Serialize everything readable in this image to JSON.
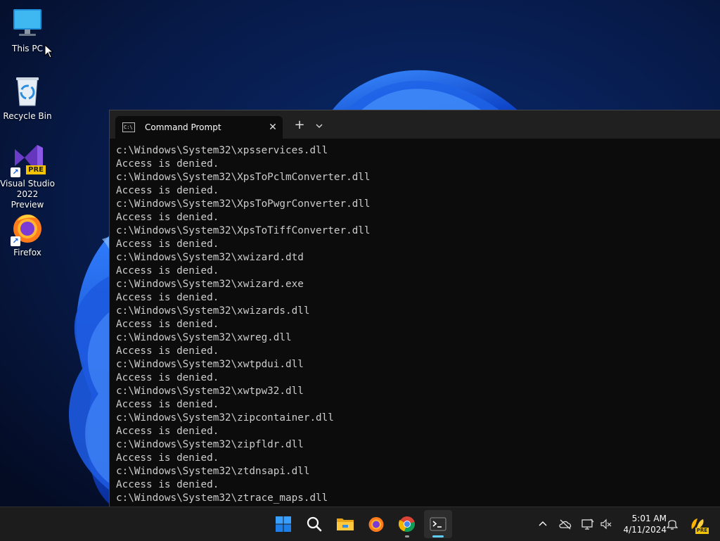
{
  "desktop": {
    "icons": [
      {
        "label": "This PC",
        "icon": "monitor-icon"
      },
      {
        "label": "Recycle Bin",
        "icon": "recycle-bin-icon"
      },
      {
        "label": "Visual Studio\n2022 Preview",
        "label_line1": "Visual Studio",
        "label_line2": "2022 Preview",
        "badge": "PRE",
        "icon": "visual-studio-icon"
      },
      {
        "label": "Firefox",
        "icon": "firefox-icon"
      }
    ]
  },
  "terminal": {
    "tab_title": "Command Prompt",
    "tab_icon_text": "C:\\",
    "close_symbol": "✕",
    "new_tab_symbol": "+",
    "lines": [
      "c:\\Windows\\System32\\xpsservices.dll",
      "Access is denied.",
      "c:\\Windows\\System32\\XpsToPclmConverter.dll",
      "Access is denied.",
      "c:\\Windows\\System32\\XpsToPwgrConverter.dll",
      "Access is denied.",
      "c:\\Windows\\System32\\XpsToTiffConverter.dll",
      "Access is denied.",
      "c:\\Windows\\System32\\xwizard.dtd",
      "Access is denied.",
      "c:\\Windows\\System32\\xwizard.exe",
      "Access is denied.",
      "c:\\Windows\\System32\\xwizards.dll",
      "Access is denied.",
      "c:\\Windows\\System32\\xwreg.dll",
      "Access is denied.",
      "c:\\Windows\\System32\\xwtpdui.dll",
      "Access is denied.",
      "c:\\Windows\\System32\\xwtpw32.dll",
      "Access is denied.",
      "c:\\Windows\\System32\\zipcontainer.dll",
      "Access is denied.",
      "c:\\Windows\\System32\\zipfldr.dll",
      "Access is denied.",
      "c:\\Windows\\System32\\ztdnsapi.dll",
      "Access is denied.",
      "c:\\Windows\\System32\\ztrace_maps.dll"
    ]
  },
  "taskbar": {
    "apps": [
      "start-icon",
      "search-icon",
      "file-explorer-icon",
      "firefox-icon",
      "chrome-icon",
      "terminal-icon"
    ],
    "clock": {
      "time": "5:01 AM",
      "date": "4/11/2024"
    },
    "tray": [
      "chevron-up-icon",
      "onedrive-offline-icon",
      "network-icon",
      "volume-muted-icon",
      "notification-bell-icon",
      "copilot-icon"
    ],
    "copilot_badge": "PRE"
  },
  "colors": {
    "console_text": "#cccccc",
    "console_bg": "#0c0c0c",
    "accent": "#60cdff"
  }
}
